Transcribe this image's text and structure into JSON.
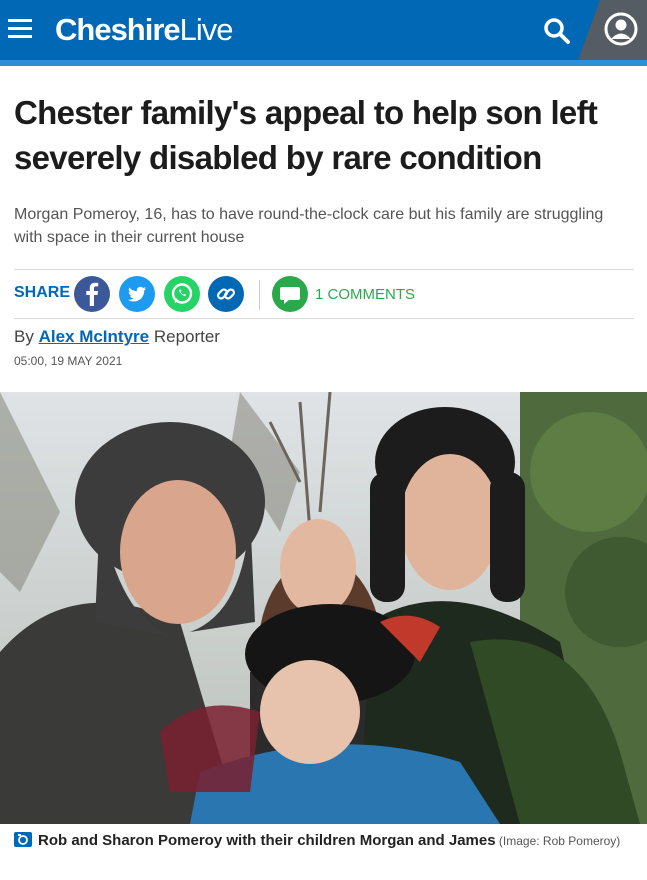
{
  "header": {
    "brand": "Cheshire",
    "brand_suffix": "Live",
    "menu_icon": "hamburger-menu-icon",
    "search_icon": "search-icon",
    "account_icon": "user-account-icon",
    "bar_color": "#0068b4"
  },
  "article": {
    "headline": "Chester family's appeal to help son left severely disabled by rare condition",
    "standfirst": "Morgan Pomeroy, 16, has to have round-the-clock care but his family are struggling with space in their current house",
    "byline_prefix": "By ",
    "author": "Alex McIntyre",
    "author_role": " Reporter",
    "timestamp": "05:00, 19 MAY 2021"
  },
  "share": {
    "label": "SHARE",
    "icons": [
      "facebook-icon",
      "twitter-icon",
      "whatsapp-icon",
      "copy-link-icon"
    ],
    "comments_label": "1 COMMENTS"
  },
  "image": {
    "caption": "Rob and Sharon Pomeroy with their children Morgan and James",
    "credit": " (Image: Rob Pomeroy)",
    "caption_icon": "camera-icon"
  }
}
